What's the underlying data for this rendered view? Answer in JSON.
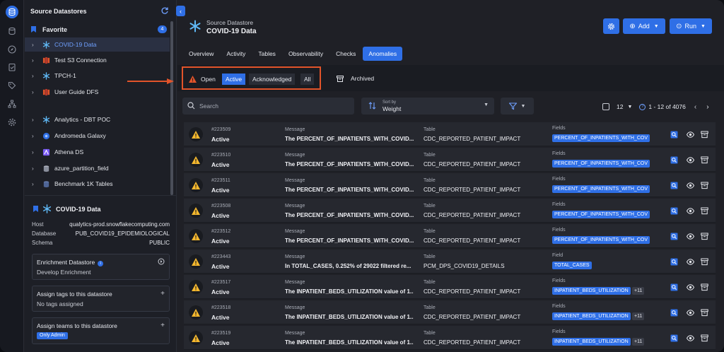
{
  "sidebar": {
    "title": "Source Datastores",
    "favorite_label": "Favorite",
    "favorite_count": "4",
    "items": [
      {
        "name": "COVID-19 Data",
        "icon": "snowflake-icon",
        "selected": true
      },
      {
        "name": "Test S3 Connection",
        "icon": "s3-icon",
        "selected": false
      },
      {
        "name": "TPCH-1",
        "icon": "snowflake-icon",
        "selected": false
      },
      {
        "name": "User Guide DFS",
        "icon": "s3-icon",
        "selected": false
      },
      {
        "name": "Analytics - DBT POC",
        "icon": "snowflake-icon",
        "selected": false
      },
      {
        "name": "Andromeda Galaxy",
        "icon": "galaxy-icon",
        "selected": false
      },
      {
        "name": "Athena DS",
        "icon": "athena-icon",
        "selected": false
      },
      {
        "name": "azure_partition_field",
        "icon": "azure-icon",
        "selected": false
      },
      {
        "name": "Benchmark 1K Tables",
        "icon": "database-icon",
        "selected": false
      }
    ],
    "detail": {
      "title": "COVID-19 Data",
      "host_label": "Host",
      "host": "qualytics-prod.snowflakecomputing.com",
      "database_label": "Database",
      "database": "PUB_COVID19_EPIDEMIOLOGICAL",
      "schema_label": "Schema",
      "schema": "PUBLIC",
      "enrichment_title": "Enrichment Datastore",
      "enrichment_value": "Develop Enrichment",
      "tags_title": "Assign tags to this datastore",
      "tags_value": "No tags assigned",
      "teams_title": "Assign teams to this datastore",
      "teams_value": "Only Admin"
    }
  },
  "header": {
    "subtitle": "Source Datastore",
    "title": "COVID-19 Data",
    "add_label": "Add",
    "run_label": "Run"
  },
  "tabs": [
    "Overview",
    "Activity",
    "Tables",
    "Observability",
    "Checks",
    "Anomalies"
  ],
  "active_tab": "Anomalies",
  "status_filter": {
    "open_label": "Open",
    "active_label": "Active",
    "acknowledged_label": "Acknowledged",
    "all_label": "All",
    "archived_label": "Archived"
  },
  "search": {
    "placeholder": "Search"
  },
  "sort": {
    "label": "Sort by",
    "value": "Weight"
  },
  "pager": {
    "page_size": "12",
    "range": "1 - 12 of 4076"
  },
  "anomalies": [
    {
      "id": "#223509",
      "status": "Active",
      "message_label": "Message",
      "message": "The PERCENT_OF_INPATIENTS_WITH_COVID...",
      "table_label": "Table",
      "table": "CDC_REPORTED_PATIENT_IMPACT",
      "fields_label": "Fields",
      "field": "PERCENT_OF_INPATIENTS_WITH_COV",
      "more": ""
    },
    {
      "id": "#223510",
      "status": "Active",
      "message_label": "Message",
      "message": "The PERCENT_OF_INPATIENTS_WITH_COVID...",
      "table_label": "Table",
      "table": "CDC_REPORTED_PATIENT_IMPACT",
      "fields_label": "Fields",
      "field": "PERCENT_OF_INPATIENTS_WITH_COV",
      "more": ""
    },
    {
      "id": "#223511",
      "status": "Active",
      "message_label": "Message",
      "message": "The PERCENT_OF_INPATIENTS_WITH_COVID...",
      "table_label": "Table",
      "table": "CDC_REPORTED_PATIENT_IMPACT",
      "fields_label": "Fields",
      "field": "PERCENT_OF_INPATIENTS_WITH_COV",
      "more": ""
    },
    {
      "id": "#223508",
      "status": "Active",
      "message_label": "Message",
      "message": "The PERCENT_OF_INPATIENTS_WITH_COVID...",
      "table_label": "Table",
      "table": "CDC_REPORTED_PATIENT_IMPACT",
      "fields_label": "Fields",
      "field": "PERCENT_OF_INPATIENTS_WITH_COV",
      "more": ""
    },
    {
      "id": "#223512",
      "status": "Active",
      "message_label": "Message",
      "message": "The PERCENT_OF_INPATIENTS_WITH_COVID...",
      "table_label": "Table",
      "table": "CDC_REPORTED_PATIENT_IMPACT",
      "fields_label": "Fields",
      "field": "PERCENT_OF_INPATIENTS_WITH_COV",
      "more": ""
    },
    {
      "id": "#223443",
      "status": "Active",
      "message_label": "Message",
      "message": "In TOTAL_CASES, 0.252% of 29022 filtered re...",
      "table_label": "Table",
      "table": "PCM_DPS_COVID19_DETAILS",
      "fields_label": "Field",
      "field": "TOTAL_CASES",
      "more": ""
    },
    {
      "id": "#223517",
      "status": "Active",
      "message_label": "Message",
      "message": "The INPATIENT_BEDS_UTILIZATION value of 1...",
      "table_label": "Table",
      "table": "CDC_REPORTED_PATIENT_IMPACT",
      "fields_label": "Fields",
      "field": "INPATIENT_BEDS_UTILIZATION",
      "more": "+11"
    },
    {
      "id": "#223518",
      "status": "Active",
      "message_label": "Message",
      "message": "The INPATIENT_BEDS_UTILIZATION value of 1...",
      "table_label": "Table",
      "table": "CDC_REPORTED_PATIENT_IMPACT",
      "fields_label": "Fields",
      "field": "INPATIENT_BEDS_UTILIZATION",
      "more": "+11"
    },
    {
      "id": "#223519",
      "status": "Active",
      "message_label": "Message",
      "message": "The INPATIENT_BEDS_UTILIZATION value of 1...",
      "table_label": "Table",
      "table": "CDC_REPORTED_PATIENT_IMPACT",
      "fields_label": "Fields",
      "field": "INPATIENT_BEDS_UTILIZATION",
      "more": "+11"
    }
  ],
  "colors": {
    "accent": "#2f6fe6",
    "highlight": "#e2542a",
    "warning": "#f5b82e"
  }
}
